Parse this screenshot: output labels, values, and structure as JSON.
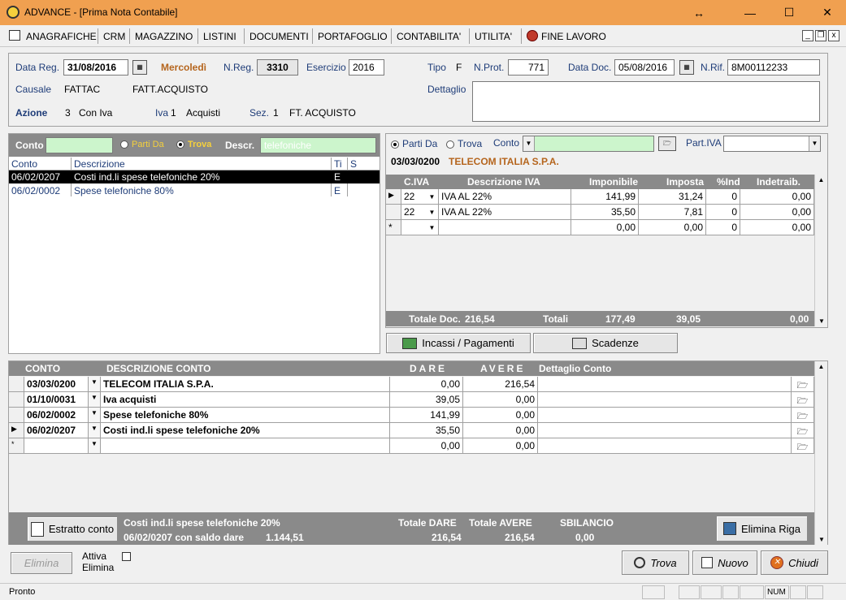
{
  "window": {
    "title": "ADVANCE - [Prima Nota Contabile]",
    "minimize": "—",
    "maximize": "☐",
    "close": "✕",
    "resize": "↔"
  },
  "menu": {
    "items": [
      "ANAGRAFICHE",
      "CRM",
      "MAGAZZINO",
      "LISTINI",
      "DOCUMENTI",
      "PORTAFOGLIO",
      "CONTABILITA'",
      "UTILITA'",
      "FINE LAVORO"
    ]
  },
  "header": {
    "data_reg_label": "Data Reg.",
    "data_reg": "31/08/2016",
    "weekday": "Mercoledì",
    "n_reg_label": "N.Reg.",
    "n_reg": "3310",
    "esercizio_label": "Esercizio",
    "esercizio": "2016",
    "tipo_label": "Tipo",
    "tipo": "F",
    "n_prot_label": "N.Prot.",
    "n_prot": "771",
    "data_doc_label": "Data Doc.",
    "data_doc": "05/08/2016",
    "n_rif_label": "N.Rif.",
    "n_rif": "8M00112233",
    "causale_label": "Causale",
    "causale_code": "FATTAC",
    "causale_desc": "FATT.ACQUISTO",
    "dettaglio_label": "Dettaglio",
    "dettaglio": "",
    "azione_label": "Azione",
    "azione_num": "3",
    "azione_desc": "Con Iva",
    "iva_label": "Iva",
    "iva_num": "1",
    "iva_desc": "Acquisti",
    "sez_label": "Sez.",
    "sez_num": "1",
    "sez_desc": "FT. ACQUISTO"
  },
  "left_search": {
    "conto_label": "Conto",
    "conto_value": "",
    "parti_da": "Parti Da",
    "trova": "Trova",
    "descr_label": "Descr.",
    "descr_value": "telefoniche",
    "columns": [
      "Conto",
      "Descrizione",
      "Ti",
      "S"
    ],
    "rows": [
      {
        "conto": "06/02/0207",
        "descr": "Costi ind.li spese telefoniche 20%",
        "ti": "E",
        "s": ""
      },
      {
        "conto": "06/02/0002",
        "descr": "Spese telefoniche 80%",
        "ti": "E",
        "s": ""
      }
    ]
  },
  "right_search": {
    "parti_da": "Parti Da",
    "trova": "Trova",
    "conto_label": "Conto",
    "conto_value": "",
    "part_iva_label": "Part.IVA",
    "part_iva_value": "",
    "account_code": "03/03/0200",
    "account_name": "TELECOM ITALIA S.P.A."
  },
  "iva_grid": {
    "columns": [
      "C.IVA",
      "Descrizione IVA",
      "Imponibile",
      "Imposta",
      "%Ind",
      "Indetraib."
    ],
    "rows": [
      {
        "civa": "22",
        "descr": "IVA AL 22%",
        "imponibile": "141,99",
        "imposta": "31,24",
        "ind": "0",
        "indetr": "0,00"
      },
      {
        "civa": "22",
        "descr": "IVA AL 22%",
        "imponibile": "35,50",
        "imposta": "7,81",
        "ind": "0",
        "indetr": "0,00"
      },
      {
        "civa": "",
        "descr": "",
        "imponibile": "0,00",
        "imposta": "0,00",
        "ind": "0",
        "indetr": "0,00"
      }
    ],
    "totale_doc_label": "Totale Doc.",
    "totale_doc": "216,54",
    "totali_label": "Totali",
    "tot_imponibile": "177,49",
    "tot_imposta": "39,05",
    "tot_indetr": "0,00"
  },
  "buttons": {
    "incassi": "Incassi / Pagamenti",
    "scadenze": "Scadenze",
    "estratto": "Estratto conto",
    "elimina_riga": "Elimina Riga",
    "elimina": "Elimina",
    "trova": "Trova",
    "nuovo": "Nuovo",
    "chiudi": "Chiudi",
    "attiva_elimina": "Attiva Elimina"
  },
  "movements": {
    "columns": [
      "CONTO",
      "DESCRIZIONE CONTO",
      "DARE",
      "AVERE",
      "Dettaglio Conto"
    ],
    "rows": [
      {
        "conto": "03/03/0200",
        "descr": "TELECOM ITALIA S.P.A.",
        "dare": "0,00",
        "avere": "216,54",
        "dett": ""
      },
      {
        "conto": "01/10/0031",
        "descr": "Iva acquisti",
        "dare": "39,05",
        "avere": "0,00",
        "dett": ""
      },
      {
        "conto": "06/02/0002",
        "descr": "Spese telefoniche 80%",
        "dare": "141,99",
        "avere": "0,00",
        "dett": ""
      },
      {
        "conto": "06/02/0207",
        "descr": "Costi ind.li spese telefoniche 20%",
        "dare": "35,50",
        "avere": "0,00",
        "dett": ""
      },
      {
        "conto": "",
        "descr": "",
        "dare": "0,00",
        "avere": "0,00",
        "dett": ""
      }
    ],
    "footer_desc": "Costi ind.li spese telefoniche 20%",
    "footer_code": "06/02/0207 con saldo dare",
    "footer_saldo": "1.144,51",
    "tot_dare_label": "Totale DARE",
    "tot_avere_label": "Totale AVERE",
    "sbilancio_label": "SBILANCIO",
    "tot_dare": "216,54",
    "tot_avere": "216,54",
    "sbilancio": "0,00"
  },
  "status": {
    "text": "Pronto",
    "num": "NUM"
  }
}
